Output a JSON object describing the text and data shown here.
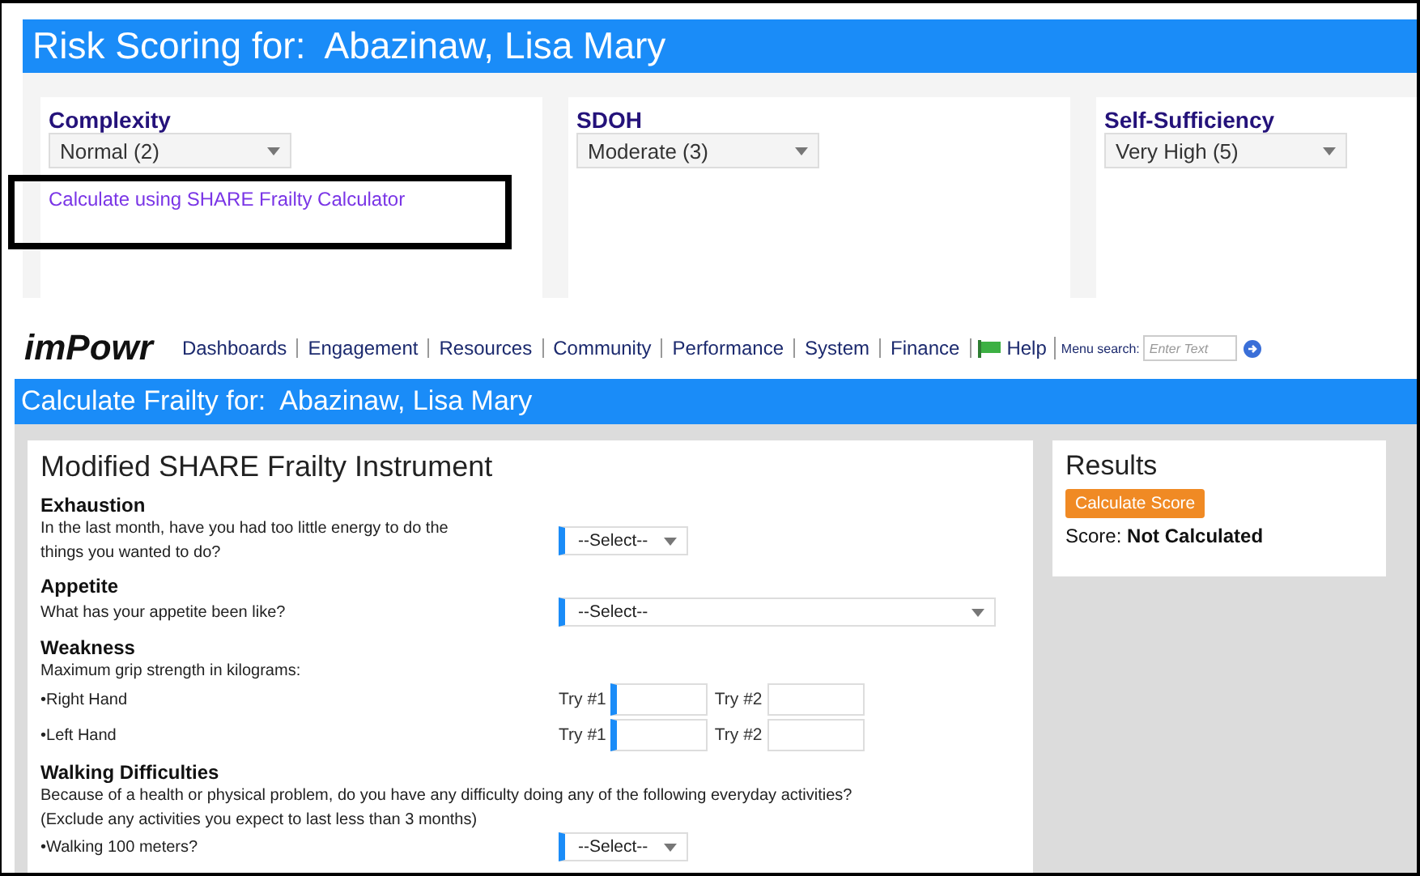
{
  "risk_scoring": {
    "title": "Risk Scoring for:  Abazinaw, Lisa Mary",
    "panels": [
      {
        "label": "Complexity",
        "value": "Normal (2)",
        "link": "Calculate using SHARE Frailty Calculator"
      },
      {
        "label": "SDOH",
        "value": "Moderate (3)"
      },
      {
        "label": "Self-Sufficiency",
        "value": "Very High (5)"
      }
    ]
  },
  "nav": {
    "logo": "imPowr",
    "items": [
      "Dashboards",
      "Engagement",
      "Resources",
      "Community",
      "Performance",
      "System",
      "Finance"
    ],
    "help": "Help",
    "search_label": "Menu search:",
    "search": {
      "placeholder": "Enter Text"
    }
  },
  "frailty": {
    "title": "Calculate Frailty for:  Abazinaw, Lisa Mary",
    "form": {
      "title": "Modified SHARE Frailty Instrument",
      "sections": [
        {
          "heading": "Exhaustion",
          "rows": [
            {
              "kind": "select",
              "label": "In the last month, have you had too little energy to do the things you wanted to do?",
              "value": "--Select--",
              "wide": false,
              "required": true
            }
          ]
        },
        {
          "heading": "Appetite",
          "rows": [
            {
              "kind": "select",
              "label": "What has your appetite been like?",
              "value": "--Select--",
              "wide": true,
              "required": true
            }
          ]
        },
        {
          "heading": "Weakness",
          "notes": [
            "Maximum grip strength in kilograms:"
          ],
          "rows": [
            {
              "kind": "grip",
              "label": "•Right Hand",
              "tries": [
                {
                  "label": "Try #1",
                  "required": true
                },
                {
                  "label": "Try #2",
                  "required": false
                }
              ]
            },
            {
              "kind": "grip",
              "label": "•Left Hand",
              "tries": [
                {
                  "label": "Try #1",
                  "required": true
                },
                {
                  "label": "Try #2",
                  "required": false
                }
              ]
            }
          ]
        },
        {
          "heading": "Walking Difficulties",
          "notes": [
            "Because of a health or physical problem, do you have any difficulty doing any of the following everyday activities?",
            "(Exclude any activities you expect to last less than 3 months)"
          ],
          "rows": [
            {
              "kind": "select",
              "label": "•Walking 100 meters?",
              "value": "--Select--",
              "wide": false,
              "required": true
            }
          ]
        }
      ]
    },
    "results": {
      "title": "Results",
      "button": "Calculate Score",
      "score_label": "Score:",
      "score_value": "Not Calculated"
    }
  }
}
